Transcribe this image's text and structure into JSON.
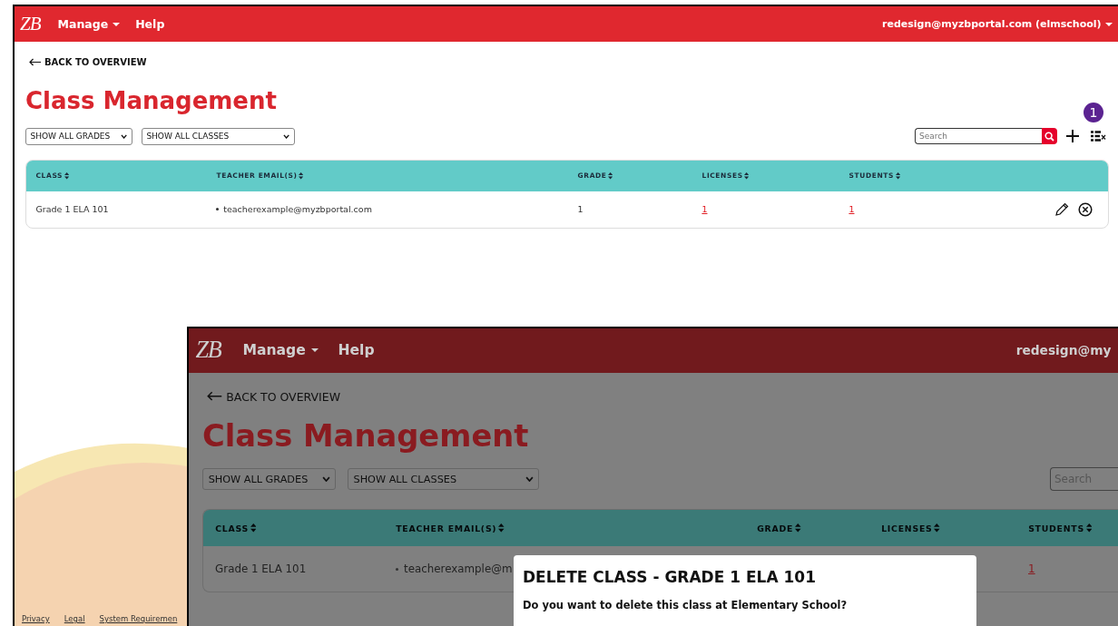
{
  "main_view": {
    "nav": {
      "logo": "ZB",
      "menu": [
        {
          "label": "Manage",
          "dropdown": true
        },
        {
          "label": "Help",
          "dropdown": false
        }
      ],
      "user": {
        "label": "redesign@myzbportal.com (elmschool)",
        "dropdown": true
      }
    },
    "back_link": "BACK TO OVERVIEW",
    "title": "Class Management",
    "filters": [
      {
        "label": "SHOW ALL GRADES",
        "kind": "grades"
      },
      {
        "label": "SHOW ALL CLASSES",
        "kind": "classes"
      }
    ],
    "search": {
      "placeholder": "Search"
    },
    "step_badge": "1",
    "table": {
      "columns": [
        "CLASS",
        "TEACHER EMAIL(S)",
        "GRADE",
        "LICENSES",
        "STUDENTS"
      ],
      "rows": [
        {
          "class": "Grade 1 ELA 101",
          "teachers": [
            "teacherexample@myzbportal.com"
          ],
          "grade": "1",
          "licenses": "1",
          "students": "1"
        }
      ]
    },
    "footer_links": [
      "Privacy",
      "Legal",
      "System Requiremen"
    ]
  },
  "dimmed_view": {
    "nav": {
      "logo": "ZB",
      "menu": [
        {
          "label": "Manage",
          "dropdown": true
        },
        {
          "label": "Help",
          "dropdown": false
        }
      ],
      "user": {
        "label": "redesign@my",
        "dropdown": false
      }
    },
    "back_link": "BACK TO OVERVIEW",
    "title": "Class Management",
    "filters": [
      {
        "label": "SHOW ALL GRADES",
        "kind": "grades"
      },
      {
        "label": "SHOW ALL CLASSES",
        "kind": "classes"
      }
    ],
    "search": {
      "placeholder": "Search"
    },
    "table": {
      "columns": [
        "CLASS",
        "TEACHER EMAIL(S)",
        "GRADE",
        "LICENSES",
        "STUDENTS"
      ],
      "rows": [
        {
          "class": "Grade 1 ELA 101",
          "teachers": [
            "teacherexample@m"
          ],
          "students": "1"
        }
      ]
    },
    "dialog": {
      "title": "DELETE CLASS - GRADE 1 ELA 101",
      "message": "Do you want to delete this class at Elementary School?"
    }
  }
}
